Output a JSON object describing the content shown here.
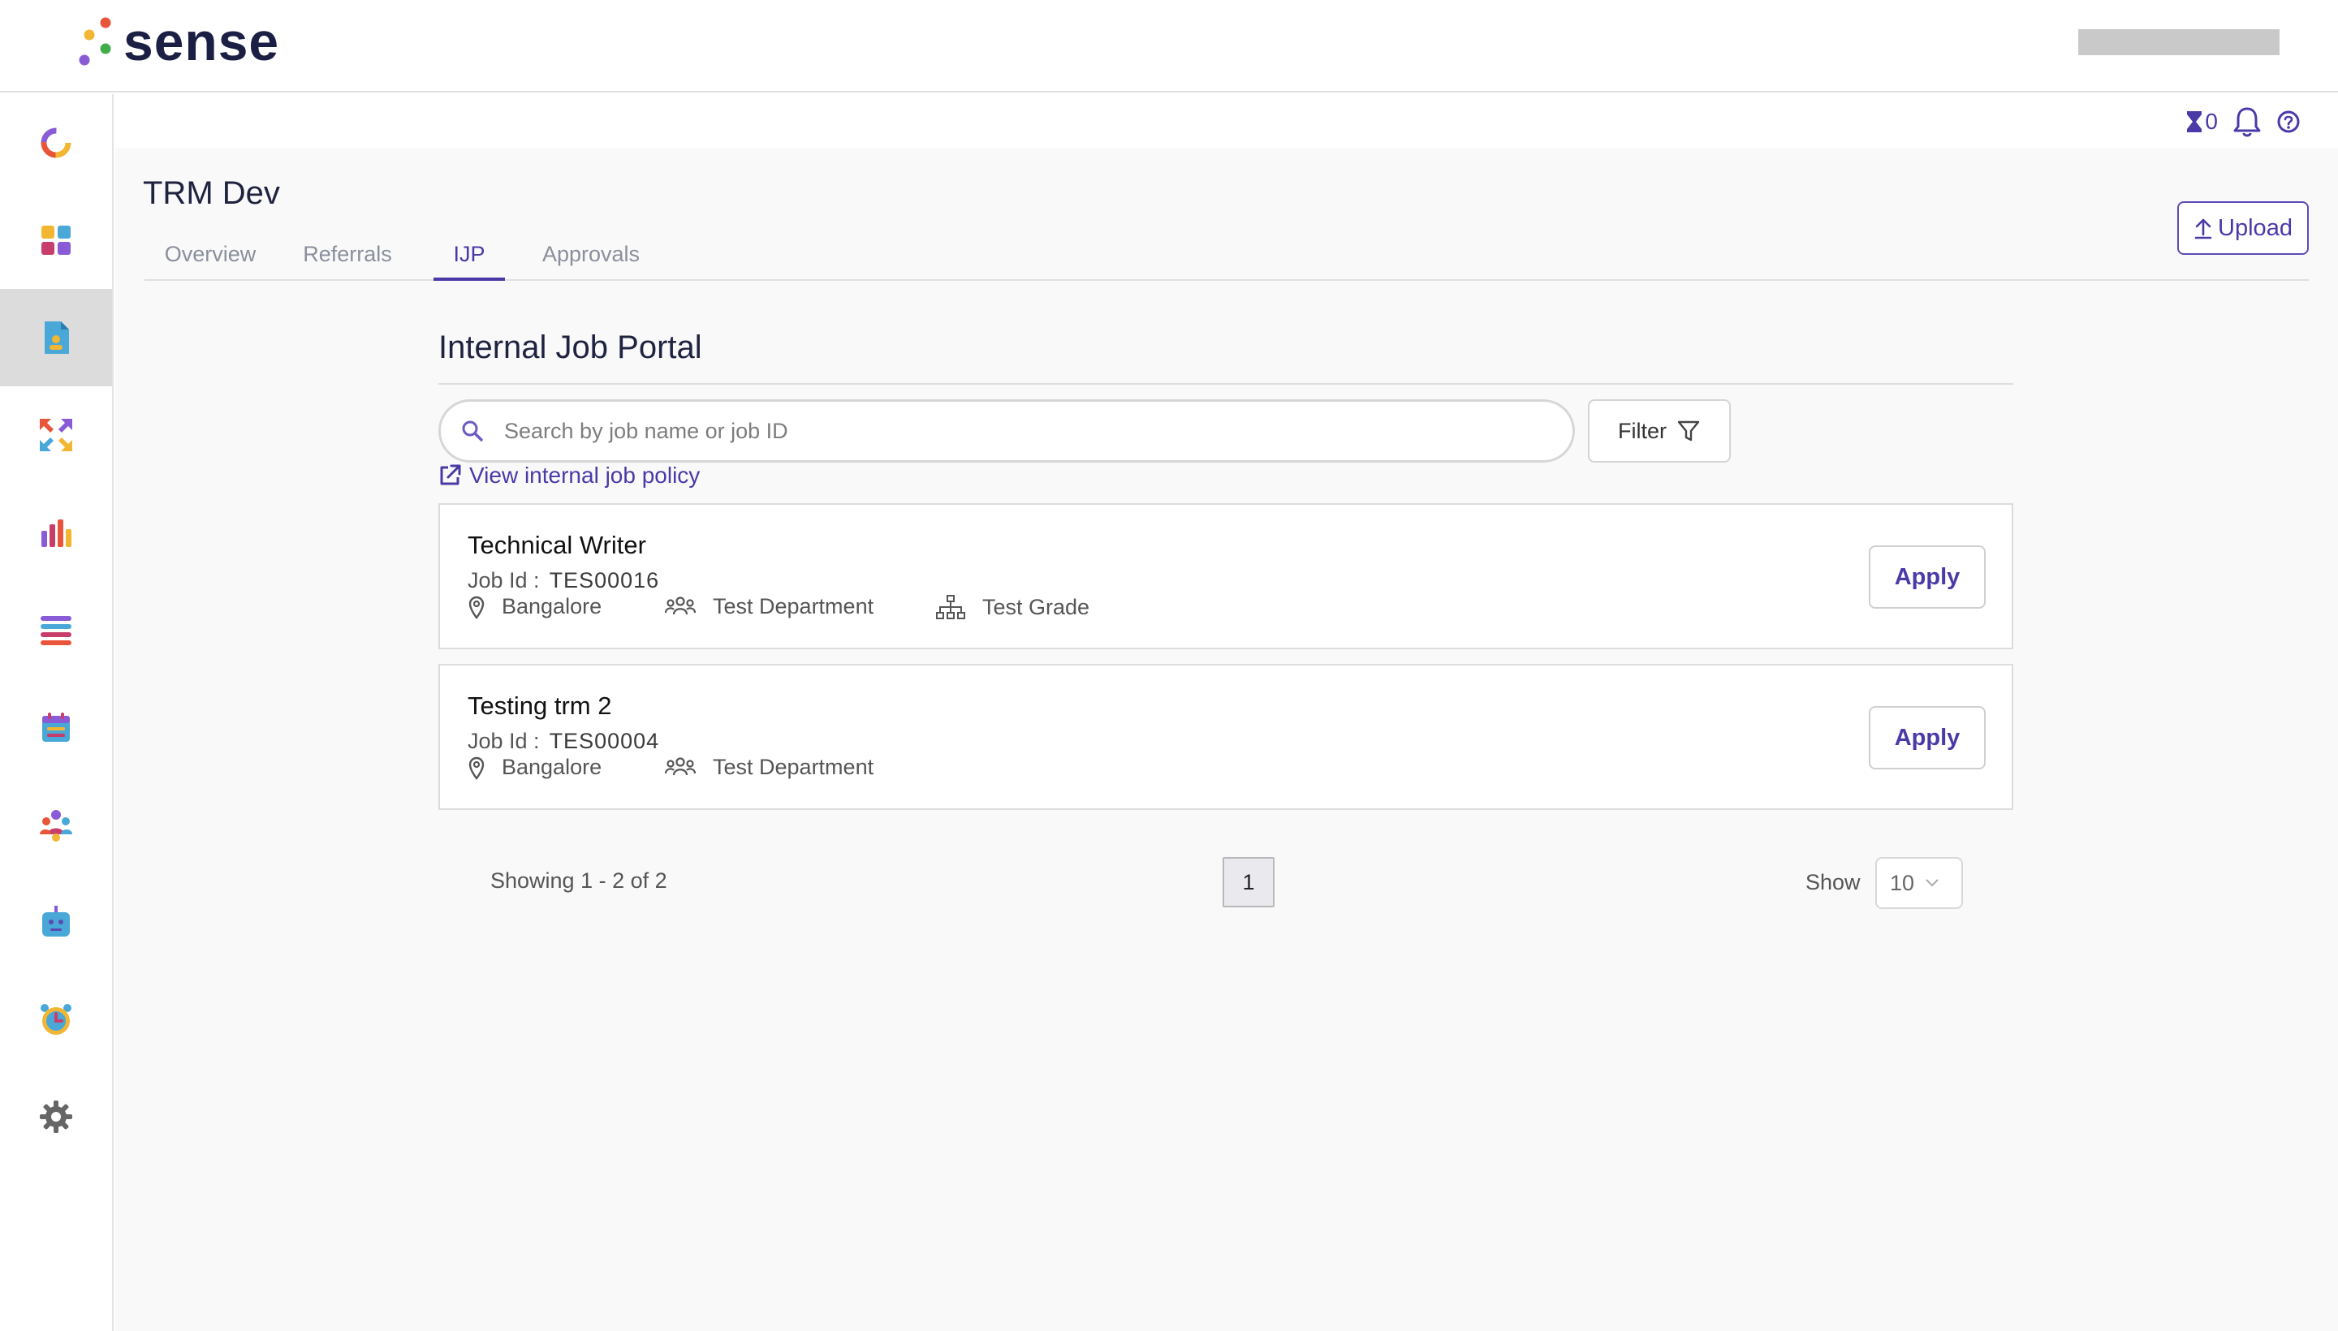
{
  "app": {
    "logo_text": "sense"
  },
  "topbar": {
    "user_name": ""
  },
  "util": {
    "timer_count": "0"
  },
  "page": {
    "title": "TRM Dev"
  },
  "tabs": [
    {
      "label": "Overview"
    },
    {
      "label": "Referrals"
    },
    {
      "label": "IJP"
    },
    {
      "label": "Approvals"
    }
  ],
  "active_tab": "IJP",
  "upload": {
    "label": "Upload"
  },
  "portal": {
    "title": "Internal Job Portal",
    "search_placeholder": "Search by job name or job ID",
    "filter_label": "Filter",
    "policy_link": "View internal job policy"
  },
  "jobs": [
    {
      "title": "Technical Writer",
      "id_label": "Job Id :",
      "id": "TES00016",
      "location": "Bangalore",
      "department": "Test Department",
      "grade": "Test Grade",
      "apply_label": "Apply"
    },
    {
      "title": "Testing trm 2",
      "id_label": "Job Id :",
      "id": "TES00004",
      "location": "Bangalore",
      "department": "Test Department",
      "apply_label": "Apply"
    }
  ],
  "pagination": {
    "showing_text": "Showing 1 - 2 of 2",
    "current_page": "1",
    "show_label": "Show",
    "page_size": "10"
  },
  "colors": {
    "accent": "#4a3aa8",
    "brand_dark": "#1b1f44",
    "sidebar_active": "#dcdcdc"
  },
  "sidebar_icons": [
    "dashboard-ring-icon",
    "apps-grid-icon",
    "document-user-icon",
    "refresh-arrows-icon",
    "bar-chart-icon",
    "list-icon",
    "calendar-icon",
    "team-icon",
    "bot-icon",
    "alarm-clock-icon",
    "settings-gear-icon"
  ]
}
